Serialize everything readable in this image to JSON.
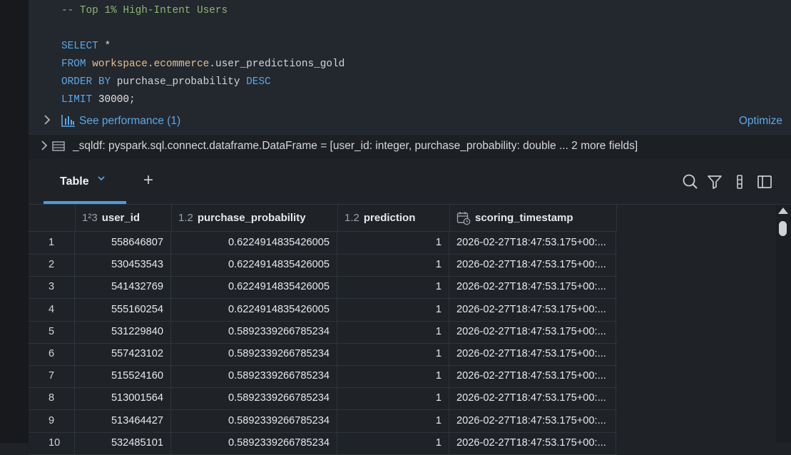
{
  "code": {
    "comment": "-- Top 1% High-Intent Users",
    "line1_kw": "SELECT",
    "line1_rest": " *",
    "line2_kw": "FROM",
    "line2_ws": "workspace",
    "line2_db": "ecommerce",
    "line2_table": "user_predictions_gold",
    "line3_kw": "ORDER BY",
    "line3_col": "purchase_probability",
    "line3_dir": "DESC",
    "line4_kw": "LIMIT",
    "line4_num": "30000",
    "line4_end": ";"
  },
  "performance": {
    "label": "See performance (1)",
    "optimize": "Optimize"
  },
  "dataframe": {
    "text": "_sqldf:  pyspark.sql.connect.dataframe.DataFrame = [user_id: integer, purchase_probability: double ... 2 more fields]"
  },
  "tabs": {
    "active": "Table",
    "add": "+"
  },
  "columns": [
    {
      "type": "1²3",
      "name": "user_id"
    },
    {
      "type": "1.2",
      "name": "purchase_probability"
    },
    {
      "type": "1.2",
      "name": "prediction"
    },
    {
      "type": "calendar-clock-icon",
      "name": "scoring_timestamp"
    }
  ],
  "rows": [
    {
      "idx": "1",
      "user_id": "558646807",
      "prob": "0.6224914835426005",
      "pred": "1",
      "ts": "2026-02-27T18:47:53.175+00:..."
    },
    {
      "idx": "2",
      "user_id": "530453543",
      "prob": "0.6224914835426005",
      "pred": "1",
      "ts": "2026-02-27T18:47:53.175+00:..."
    },
    {
      "idx": "3",
      "user_id": "541432769",
      "prob": "0.6224914835426005",
      "pred": "1",
      "ts": "2026-02-27T18:47:53.175+00:..."
    },
    {
      "idx": "4",
      "user_id": "555160254",
      "prob": "0.6224914835426005",
      "pred": "1",
      "ts": "2026-02-27T18:47:53.175+00:..."
    },
    {
      "idx": "5",
      "user_id": "531229840",
      "prob": "0.5892339266785234",
      "pred": "1",
      "ts": "2026-02-27T18:47:53.175+00:..."
    },
    {
      "idx": "6",
      "user_id": "557423102",
      "prob": "0.5892339266785234",
      "pred": "1",
      "ts": "2026-02-27T18:47:53.175+00:..."
    },
    {
      "idx": "7",
      "user_id": "515524160",
      "prob": "0.5892339266785234",
      "pred": "1",
      "ts": "2026-02-27T18:47:53.175+00:..."
    },
    {
      "idx": "8",
      "user_id": "513001564",
      "prob": "0.5892339266785234",
      "pred": "1",
      "ts": "2026-02-27T18:47:53.175+00:..."
    },
    {
      "idx": "9",
      "user_id": "513464427",
      "prob": "0.5892339266785234",
      "pred": "1",
      "ts": "2026-02-27T18:47:53.175+00:..."
    },
    {
      "idx": "10",
      "user_id": "532485101",
      "prob": "0.5892339266785234",
      "pred": "1",
      "ts": "2026-02-27T18:47:53.175+00:..."
    }
  ],
  "colors": {
    "accent": "#4a9de0",
    "keyword": "#5aa9e6",
    "comment": "#8fb573",
    "identifier": "#e2c08d"
  }
}
